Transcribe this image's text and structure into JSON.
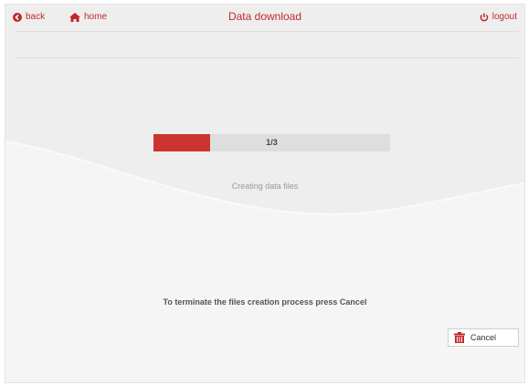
{
  "header": {
    "back_label": "back",
    "home_label": "home",
    "title": "Data download",
    "logout_label": "logout"
  },
  "progress": {
    "label": "1/3",
    "fraction": 0.24
  },
  "status_text": "Creating data files",
  "instruction_text": "To terminate the files creation process press Cancel",
  "cancel_button": {
    "label": "Cancel"
  },
  "colors": {
    "accent": "#c0282b",
    "progress_fill": "#cb3431",
    "progress_track": "#dedede"
  },
  "icons": {
    "back": "back-arrow-circle-icon",
    "home": "home-icon",
    "logout": "power-icon",
    "cancel": "trash-icon"
  }
}
